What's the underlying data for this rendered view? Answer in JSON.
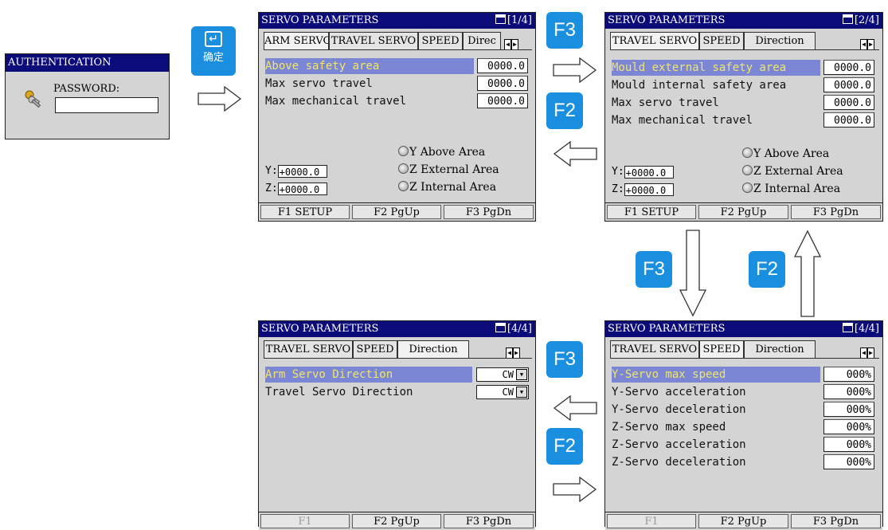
{
  "auth": {
    "title": "AUTHENTICATION",
    "password_label": "PASSWORD:",
    "password_value": "",
    "icon": "keys-icon"
  },
  "confirm_key": {
    "label": "确定",
    "icon": "enter-icon"
  },
  "fkeys": {
    "f3": "F3",
    "f2": "F2"
  },
  "screens": {
    "p1": {
      "title": "SERVO PARAMETERS",
      "page": "[1/4]",
      "tabs": [
        "ARM SERVO",
        "TRAVEL SERVO",
        "SPEED",
        "Direc"
      ],
      "rows": [
        {
          "label": "Above safety area",
          "value": "0000.0"
        },
        {
          "label": "Max servo travel",
          "value": "0000.0"
        },
        {
          "label": "Max mechanical travel",
          "value": "0000.0"
        }
      ],
      "y_label": "Y:",
      "y_value": "+0000.0",
      "z_label": "Z:",
      "z_value": "+0000.0",
      "radios": [
        "Y Above Area",
        "Z External Area",
        "Z Internal Area"
      ],
      "fbar": [
        "F1 SETUP",
        "F2 PgUp",
        "F3 PgDn"
      ]
    },
    "p2": {
      "title": "SERVO PARAMETERS",
      "page": "[2/4]",
      "tabs": [
        "TRAVEL SERVO",
        "SPEED",
        "Direction"
      ],
      "rows": [
        {
          "label": "Mould external safety area",
          "value": "0000.0"
        },
        {
          "label": "Mould internal safety area",
          "value": "0000.0"
        },
        {
          "label": "Max servo travel",
          "value": "0000.0"
        },
        {
          "label": "Max mechanical travel",
          "value": "0000.0"
        }
      ],
      "y_label": "Y:",
      "y_value": "+0000.0",
      "z_label": "Z:",
      "z_value": "+0000.0",
      "radios": [
        "Y Above Area",
        "Z External Area",
        "Z Internal Area"
      ],
      "fbar": [
        "F1 SETUP",
        "F2 PgUp",
        "F3 PgDn"
      ]
    },
    "p3": {
      "title": "SERVO PARAMETERS",
      "page": "[4/4]",
      "tabs": [
        "TRAVEL SERVO",
        "SPEED",
        "Direction"
      ],
      "rows": [
        {
          "label": "Arm Servo Direction",
          "value": "CW"
        },
        {
          "label": "Travel Servo Direction",
          "value": "CW"
        }
      ],
      "fbar": [
        "F1",
        "F2 PgUp",
        "F3 PgDn"
      ]
    },
    "p4": {
      "title": "SERVO PARAMETERS",
      "page": "[4/4]",
      "tabs": [
        "TRAVEL SERVO",
        "SPEED",
        "Direction"
      ],
      "rows": [
        {
          "label": "Y-Servo max speed",
          "value": "000%"
        },
        {
          "label": "Y-Servo acceleration",
          "value": "000%"
        },
        {
          "label": "Y-Servo deceleration",
          "value": "000%"
        },
        {
          "label": "Z-Servo max speed",
          "value": "000%"
        },
        {
          "label": "Z-Servo acceleration",
          "value": "000%"
        },
        {
          "label": "Z-Servo deceleration",
          "value": "000%"
        }
      ],
      "fbar": [
        "F1",
        "F2 PgUp",
        "F3 PgDn"
      ]
    }
  },
  "colors": {
    "titlebar": "#0b0b7a",
    "selection": "#7b86d4",
    "selection_text": "#f0e66a",
    "fkey": "#1a8fe0"
  }
}
